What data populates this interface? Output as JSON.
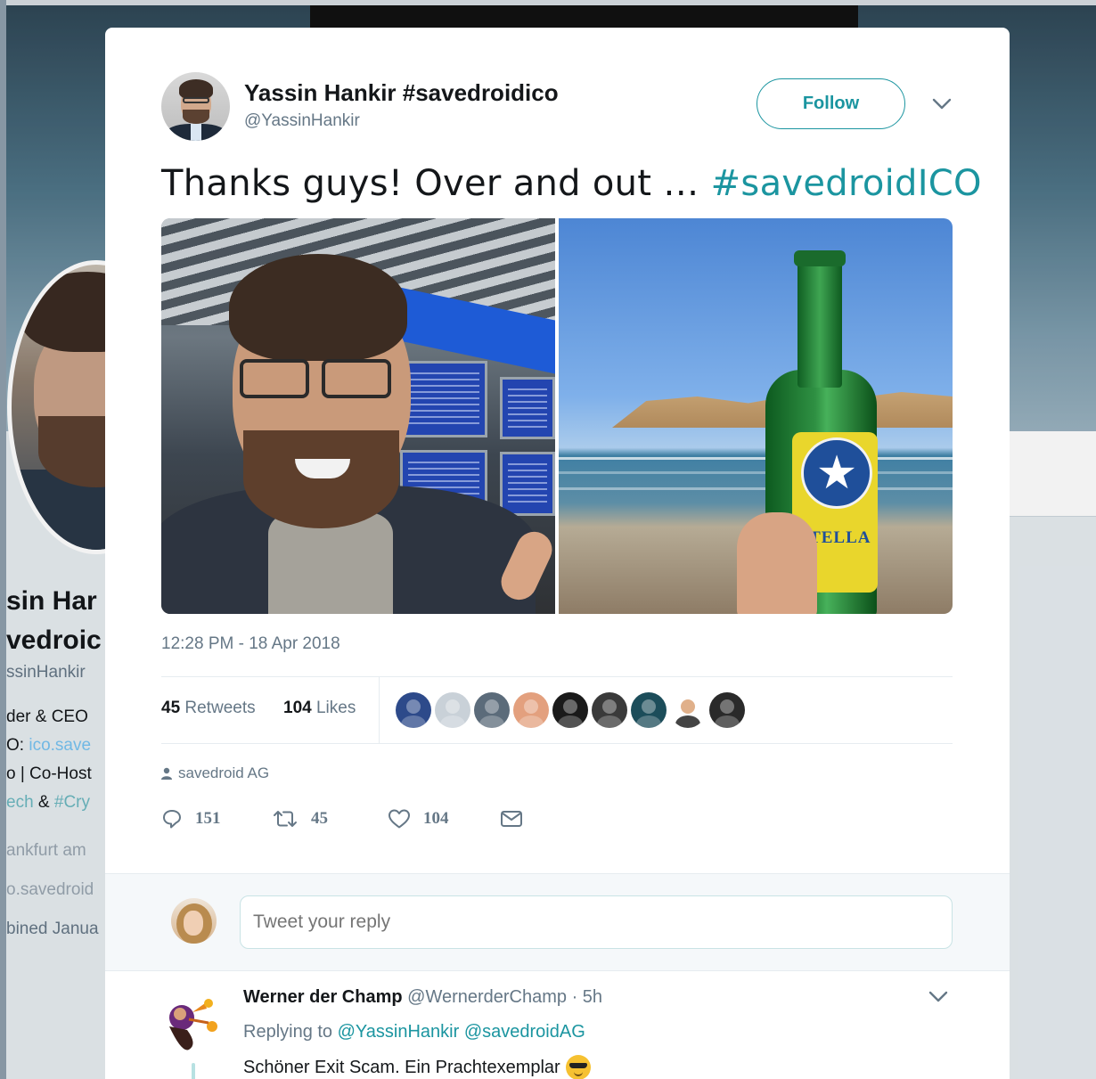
{
  "background_profile": {
    "name_line1": "sin Har",
    "name_line2": "vedroic",
    "handle": "ssinHankir",
    "bio_line1": "der & CEO",
    "bio_line2_prefix": "O: ",
    "bio_line2_link": "ico.save",
    "bio_line3": "o | Co-Host",
    "bio_line4_tag1": "ech",
    "bio_line4_amp": " & ",
    "bio_line4_tag2": "#Cry",
    "location": "ankfurt am",
    "website": "o.savedroid",
    "joined": "bined Janua"
  },
  "tweet": {
    "author_name": "Yassin Hankir #savedroidico",
    "author_handle": "@YassinHankir",
    "follow_label": "Follow",
    "text": "Thanks guys! Over and out … ",
    "hashtag": "#savedroidICO",
    "bottle_label": "STELLA",
    "timestamp": "12:28 PM - 18 Apr 2018",
    "retweets_count": "45",
    "retweets_label": "Retweets",
    "likes_count": "104",
    "likes_label": "Likes",
    "source": "savedroid AG",
    "reply_count": "151",
    "retweet_count": "45",
    "like_count": "104"
  },
  "liker_avatars": [
    {
      "name": "liker-avatar-1",
      "color": "#2d4a8a"
    },
    {
      "name": "liker-avatar-2",
      "color": "#c9d1d8"
    },
    {
      "name": "liker-avatar-3",
      "color": "#5b6b7a"
    },
    {
      "name": "liker-avatar-4",
      "color": "#e3a07e"
    },
    {
      "name": "liker-avatar-5",
      "color": "#1a1a1a"
    },
    {
      "name": "liker-avatar-6",
      "color": "#3a3a3a"
    },
    {
      "name": "liker-avatar-7",
      "color": "#1c4d5a"
    },
    {
      "name": "liker-avatar-8",
      "color": "#ffffff"
    },
    {
      "name": "liker-avatar-9",
      "color": "#2a2a2a"
    }
  ],
  "reply_box": {
    "placeholder": "Tweet your reply"
  },
  "reply": {
    "author_name": "Werner der Champ",
    "author_handle": "@WernerderChamp",
    "time": " · 5h",
    "replying_to_label": "Replying to ",
    "mention1": "@YassinHankir",
    "mention2": "@savedroidAG",
    "text": "Schöner Exit Scam. Ein Prachtexemplar",
    "emoji": "sunglasses-emoji"
  },
  "colors": {
    "accent": "#1b95a0",
    "muted": "#657786",
    "text": "#14171a",
    "background": "#e6ecf0"
  }
}
